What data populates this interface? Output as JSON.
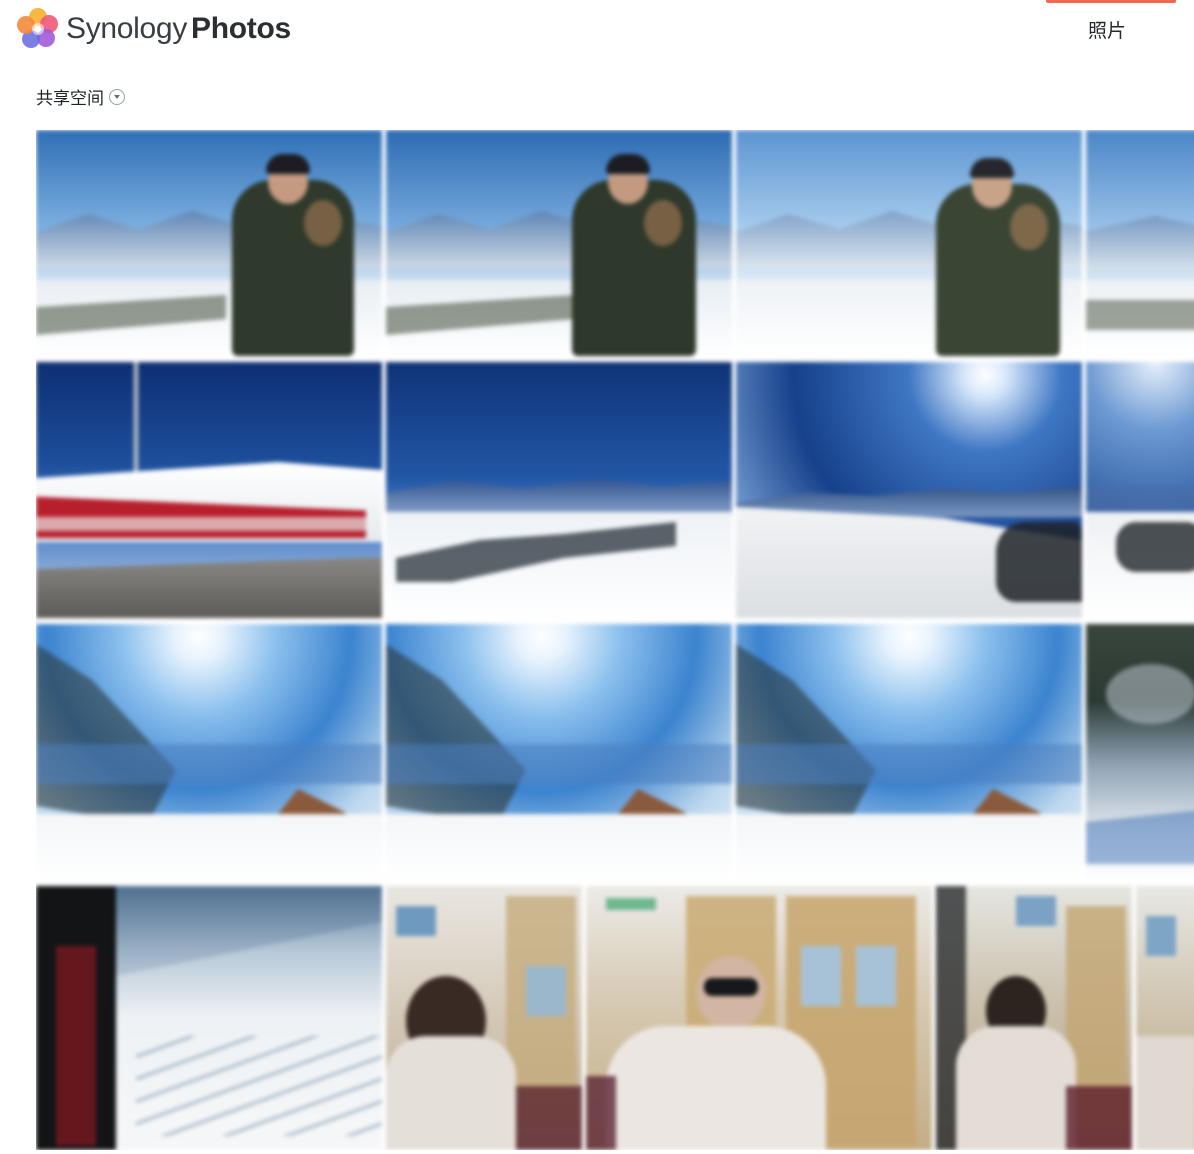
{
  "header": {
    "brand_light": "Synology",
    "brand_bold": "Photos",
    "logo_icon": "synology-photos-flower-icon",
    "nav": {
      "active_tab_label": "照片",
      "accent_color": "#f2694f"
    }
  },
  "space_selector": {
    "label": "共享空间",
    "icon": "chevron-down-icon"
  },
  "photo_grid": {
    "rows": [
      {
        "photos": [
          {
            "subject": "person-mountain-snow"
          },
          {
            "subject": "person-mountain-snow"
          },
          {
            "subject": "person-mountain-snow"
          },
          {
            "subject": "mountain-snow"
          }
        ]
      },
      {
        "photos": [
          {
            "subject": "red-train-snow"
          },
          {
            "subject": "snowy-ridge"
          },
          {
            "subject": "snowy-ridge-sun"
          },
          {
            "subject": "snowy-ridge"
          }
        ]
      },
      {
        "photos": [
          {
            "subject": "snow-trees-sun"
          },
          {
            "subject": "snow-trees-sun"
          },
          {
            "subject": "snow-trees-sun"
          },
          {
            "subject": "snow-tree-branch"
          }
        ]
      },
      {
        "photos": [
          {
            "subject": "train-window-rails"
          },
          {
            "subject": "person-train-interior"
          },
          {
            "subject": "person-sunglasses-train"
          },
          {
            "subject": "person-train-interior"
          },
          {
            "subject": "train-interior"
          }
        ]
      }
    ]
  }
}
